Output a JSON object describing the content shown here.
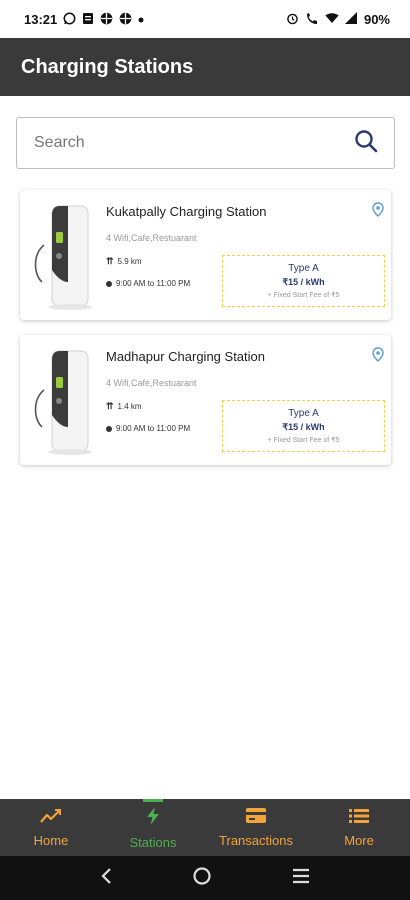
{
  "status_bar": {
    "time": "13:21",
    "left_icons": [
      "whatsapp-icon",
      "notes-icon",
      "grid-icon",
      "grid-icon",
      "dot-icon"
    ],
    "right_icons": [
      "alarm-icon",
      "wifi-call-icon",
      "wifi-icon",
      "signal-icon"
    ],
    "battery": "90%"
  },
  "app_bar": {
    "title": "Charging Stations"
  },
  "search": {
    "placeholder": "Search",
    "icon": "search-icon"
  },
  "stations": [
    {
      "name": "Kukatpally Charging Station",
      "amenities": "4 Wifi,Cafe,Restuarant",
      "distance": "5.9 km",
      "hours": "9:00 AM to 11:00 PM",
      "price_type": "Type A",
      "price_rate": "₹15 / kWh",
      "price_fee": "+ Fixed Start Fee of ₹5"
    },
    {
      "name": "Madhapur Charging Station",
      "amenities": "4 Wifi,Cafe,Restuarant",
      "distance": "1.4 km",
      "hours": "9:00 AM to 11:00 PM",
      "price_type": "Type A",
      "price_rate": "₹15 / kWh",
      "price_fee": "+ Fixed Start Fee of ₹5"
    }
  ],
  "bottom_nav": {
    "items": [
      {
        "label": "Home",
        "icon": "trend-icon"
      },
      {
        "label": "Stations",
        "icon": "bolt-icon",
        "active": true
      },
      {
        "label": "Transactions",
        "icon": "card-icon"
      },
      {
        "label": "More",
        "icon": "list-icon"
      }
    ]
  },
  "colors": {
    "app_bar": "#3a3a3a",
    "accent_orange": "#f2a33a",
    "active_green": "#4caf50",
    "price_text": "#2b3a6e",
    "price_border": "#e8d44a",
    "pin": "#5b9bd5"
  }
}
